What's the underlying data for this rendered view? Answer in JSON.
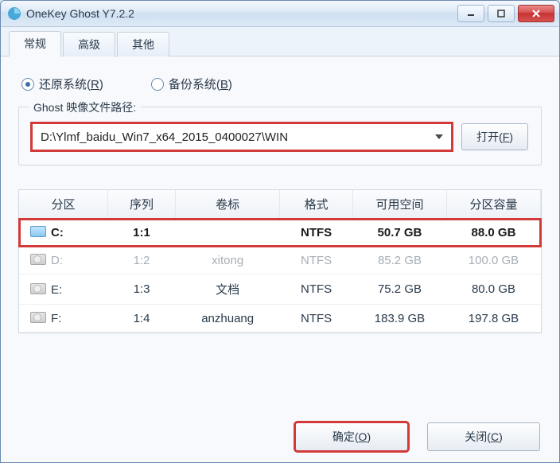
{
  "titlebar": {
    "title": "OneKey Ghost Y7.2.2"
  },
  "tabs": {
    "general": "常规",
    "advanced": "高级",
    "other": "其他"
  },
  "radios": {
    "restore": "还原系统",
    "restore_key": "R",
    "backup": "备份系统",
    "backup_key": "B"
  },
  "ghost_group": {
    "label": "Ghost 映像文件路径:",
    "path": "D:\\Ylmf_baidu_Win7_x64_2015_0400027\\WIN",
    "open": "打开",
    "open_key": "F"
  },
  "table": {
    "headers": {
      "partition": "分区",
      "seq": "序列",
      "label": "卷标",
      "format": "格式",
      "free": "可用空间",
      "capacity": "分区容量"
    },
    "rows": [
      {
        "drive": "C:",
        "seq": "1:1",
        "label": "",
        "format": "NTFS",
        "free": "50.7 GB",
        "capacity": "88.0 GB",
        "selected": true,
        "icon": "win"
      },
      {
        "drive": "D:",
        "seq": "1:2",
        "label": "xitong",
        "format": "NTFS",
        "free": "85.2 GB",
        "capacity": "100.0 GB",
        "muted": true,
        "icon": "cd"
      },
      {
        "drive": "E:",
        "seq": "1:3",
        "label": "文档",
        "format": "NTFS",
        "free": "75.2 GB",
        "capacity": "80.0 GB",
        "icon": "cd"
      },
      {
        "drive": "F:",
        "seq": "1:4",
        "label": "anzhuang",
        "format": "NTFS",
        "free": "183.9 GB",
        "capacity": "197.8 GB",
        "icon": "cd"
      }
    ]
  },
  "footer": {
    "ok": "确定",
    "ok_key": "O",
    "close": "关闭",
    "close_key": "C"
  }
}
